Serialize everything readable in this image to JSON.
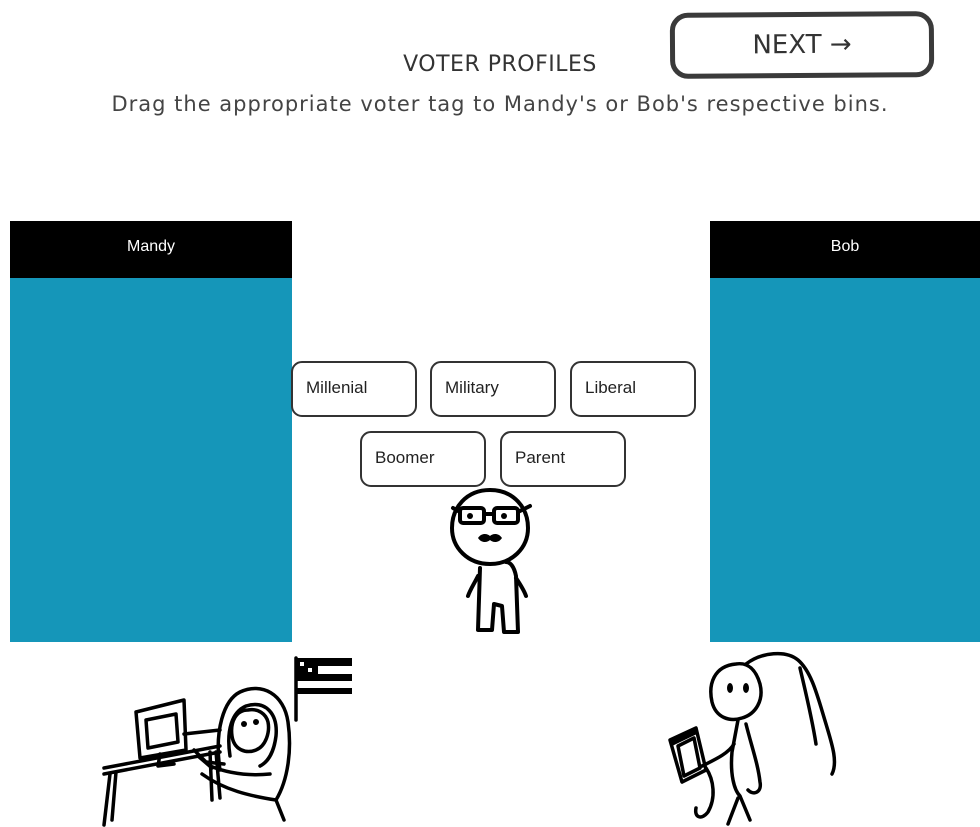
{
  "header": {
    "title": "VOTER PROFILES",
    "instructions": "Drag the appropriate voter tag to Mandy's or Bob's respective bins.",
    "next_label": "NEXT →"
  },
  "bins": [
    {
      "name": "Mandy"
    },
    {
      "name": "Bob"
    }
  ],
  "tags": [
    "Millenial",
    "Military",
    "Liberal",
    "Boomer",
    "Parent"
  ],
  "colors": {
    "bin_body": "#1596b9",
    "bin_header": "#000000"
  }
}
